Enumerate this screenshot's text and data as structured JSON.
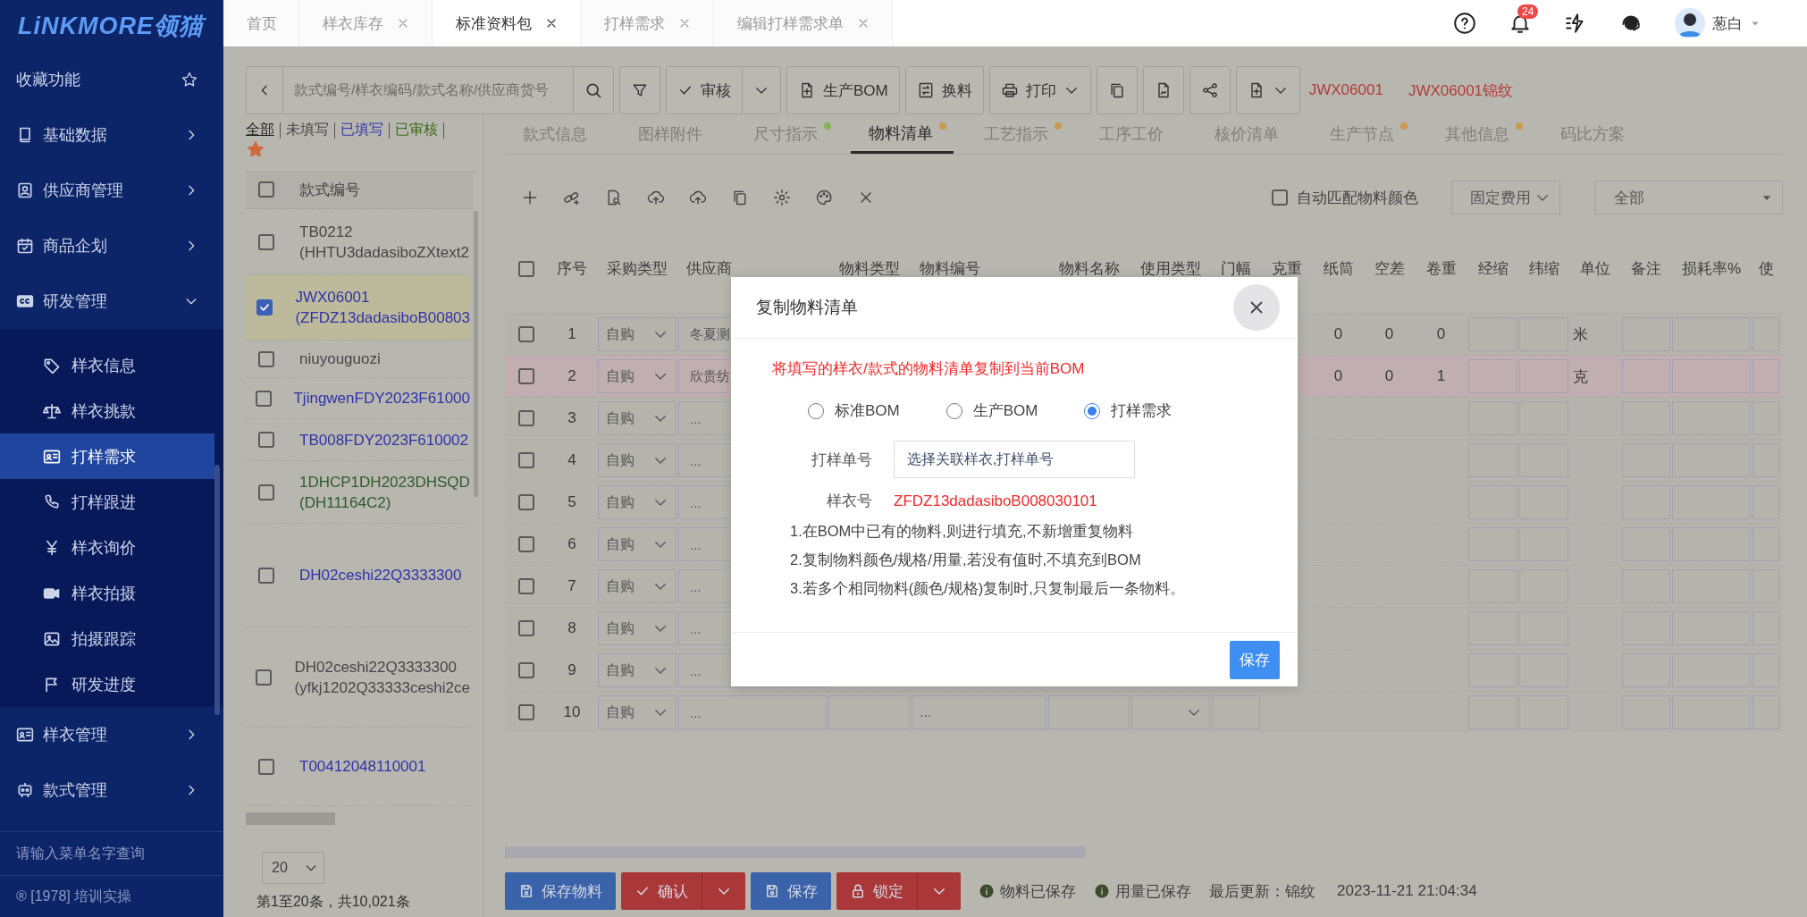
{
  "sidebar": {
    "logo": "LiNKMORE领猫",
    "items": [
      {
        "kind": "favorites",
        "label": "收藏功能"
      },
      {
        "kind": "menu",
        "label": "基础数据",
        "expanded": false
      },
      {
        "kind": "menu",
        "label": "供应商管理",
        "expanded": false
      },
      {
        "kind": "menu",
        "label": "商品企划",
        "expanded": false
      },
      {
        "kind": "menu",
        "label": "研发管理",
        "expanded": true,
        "children": [
          {
            "label": "样衣信息",
            "selected": false
          },
          {
            "label": "样衣挑款",
            "selected": false
          },
          {
            "label": "打样需求",
            "selected": true
          },
          {
            "label": "打样跟进",
            "selected": false
          },
          {
            "label": "样衣询价",
            "selected": false
          },
          {
            "label": "样衣拍摄",
            "selected": false
          },
          {
            "label": "拍摄跟踪",
            "selected": false
          },
          {
            "label": "研发进度",
            "selected": false
          }
        ]
      },
      {
        "kind": "menu",
        "label": "样衣管理",
        "expanded": false
      },
      {
        "kind": "menu",
        "label": "款式管理",
        "expanded": false
      }
    ],
    "search_placeholder": "请输入菜单名字查询",
    "footer": "® [1978] 培训实操"
  },
  "header": {
    "tabs": [
      {
        "label": "首页",
        "closable": false,
        "selected": false
      },
      {
        "label": "样衣库存",
        "closable": true,
        "selected": false
      },
      {
        "label": "标准资料包",
        "closable": true,
        "selected": true
      },
      {
        "label": "打样需求",
        "closable": true,
        "selected": false
      },
      {
        "label": "编辑打样需求单",
        "closable": true,
        "selected": false
      }
    ],
    "notification_count": "24",
    "user": "葱白"
  },
  "toolbar": {
    "search_placeholder": "款式编号/样衣编码/款式名称/供应商货号",
    "buttons": [
      {
        "kind": "icon",
        "caret": false
      },
      {
        "kind": "split",
        "label": "审核",
        "caret": true
      },
      {
        "kind": "text",
        "label": "生产BOM",
        "caret": false
      },
      {
        "kind": "text",
        "label": "换料",
        "caret": false
      },
      {
        "kind": "text",
        "label": "打印",
        "caret": true
      },
      {
        "kind": "icon",
        "caret": false
      },
      {
        "kind": "icon",
        "caret": false
      },
      {
        "kind": "icon",
        "caret": false
      },
      {
        "kind": "icon",
        "caret": true
      }
    ],
    "codes": [
      "JWX06001",
      "JWX06001锦纹"
    ]
  },
  "list": {
    "filters": [
      {
        "label": "全部",
        "selected": true,
        "color": "#1e1e1e"
      },
      {
        "label": "未填写",
        "selected": false,
        "color": "#474747"
      },
      {
        "label": "已填写",
        "selected": false,
        "color": "#3636b0"
      },
      {
        "label": "已审核",
        "selected": false,
        "color": "#3c6a1c"
      }
    ],
    "column": "款式编号",
    "select_all_checked": false,
    "rows": [
      {
        "lines": [
          "TB0212",
          "(HHTU3dadasiboZXtext2"
        ],
        "checked": false,
        "selected": false,
        "color": "#474747"
      },
      {
        "lines": [
          "JWX06001",
          "(ZFDZ13dadasiboB00803"
        ],
        "checked": true,
        "selected": true,
        "color": "#3232a8"
      },
      {
        "lines": [
          "niuyouguozi"
        ],
        "checked": false,
        "selected": false,
        "color": "#474747"
      },
      {
        "lines": [
          "TjingwenFDY2023F61000"
        ],
        "checked": false,
        "selected": false,
        "color": "#3232a8"
      },
      {
        "lines": [
          "TB008FDY2023F610002"
        ],
        "checked": false,
        "selected": false,
        "color": "#3232a8"
      },
      {
        "lines": [
          "1DHCP1DH2023DHSQD",
          "(DH11164C2)"
        ],
        "checked": false,
        "selected": false,
        "color": "#2f5a2f"
      },
      {
        "lines": [
          "DH02ceshi22Q3333300"
        ],
        "checked": false,
        "selected": false,
        "color": "#3232a8"
      },
      {
        "lines": [
          "DH02ceshi22Q3333300",
          "(yfkj1202Q33333ceshi2ce"
        ],
        "checked": false,
        "selected": false,
        "color": "#474747"
      },
      {
        "lines": [
          "T00412048110001"
        ],
        "checked": false,
        "selected": false,
        "color": "#3232a8"
      }
    ],
    "page_size": "20",
    "summary": "第1至20条，共10,021条"
  },
  "main": {
    "tabs": [
      {
        "label": "款式信息",
        "selected": false
      },
      {
        "label": "图样附件",
        "selected": false
      },
      {
        "label": "尺寸指示",
        "selected": false,
        "color": "#86b25e"
      },
      {
        "label": "物料清单",
        "selected": true,
        "color": "#c99a50"
      },
      {
        "label": "工艺指示",
        "selected": false,
        "color": "#c99a50"
      },
      {
        "label": "工序工价",
        "selected": false
      },
      {
        "label": "核价清单",
        "selected": false
      },
      {
        "label": "生产节点",
        "selected": false,
        "color": "#c99a50"
      },
      {
        "label": "其他信息",
        "selected": false,
        "color": "#c99a50"
      },
      {
        "label": "码比方案",
        "selected": false
      }
    ],
    "auto_match": {
      "label": "自动匹配物料颜色",
      "checked": false
    },
    "selects": [
      "固定费用",
      "全部"
    ],
    "table": {
      "select_all_checked": false,
      "columns": [
        "序号",
        "采购类型",
        "供应商",
        "物料类型",
        "物料编号",
        "物料名称",
        "使用类型",
        "门幅",
        "克重",
        "纸筒",
        "空差",
        "卷重",
        "经缩",
        "纬缩",
        "单位",
        "备注",
        "损耗率%",
        "使"
      ],
      "rows": [
        {
          "seq": "1",
          "purchase_type": "自购",
          "supplier": "冬夏测",
          "checked": false,
          "highlighted": false,
          "paper_tube": "0",
          "gap": "0",
          "roll_weight": "0",
          "unit": "米"
        },
        {
          "seq": "2",
          "purchase_type": "自购",
          "supplier": "欣贵纺",
          "checked": false,
          "highlighted": true,
          "paper_tube": "0",
          "gap": "0",
          "roll_weight": "1",
          "unit": "克"
        },
        {
          "seq": "3",
          "purchase_type": "自购",
          "supplier": "...",
          "checked": false,
          "highlighted": false
        },
        {
          "seq": "4",
          "purchase_type": "自购",
          "supplier": "...",
          "checked": false,
          "highlighted": false
        },
        {
          "seq": "5",
          "purchase_type": "自购",
          "supplier": "...",
          "checked": false,
          "highlighted": false
        },
        {
          "seq": "6",
          "purchase_type": "自购",
          "supplier": "...",
          "checked": false,
          "highlighted": false
        },
        {
          "seq": "7",
          "purchase_type": "自购",
          "supplier": "...",
          "checked": false,
          "highlighted": false
        },
        {
          "seq": "8",
          "purchase_type": "自购",
          "supplier": "...",
          "checked": false,
          "highlighted": false
        },
        {
          "seq": "9",
          "purchase_type": "自购",
          "supplier": "...",
          "checked": false,
          "highlighted": false
        },
        {
          "seq": "10",
          "purchase_type": "自购",
          "supplier": "...",
          "checked": false,
          "highlighted": false,
          "material_code": "...",
          "usage_select": true
        }
      ]
    },
    "actions": [
      {
        "label": "保存物料",
        "kind": "primary",
        "caret": false
      },
      {
        "label": "确认",
        "kind": "danger",
        "caret": true
      },
      {
        "label": "保存",
        "kind": "primary",
        "caret": false
      },
      {
        "label": "锁定",
        "kind": "danger",
        "caret": true
      }
    ],
    "statuses": [
      "物料已保存",
      "用量已保存"
    ],
    "last_update": "最后更新：锦纹",
    "timestamp": "2023-11-21 21:04:34"
  },
  "dialog": {
    "title": "复制物料清单",
    "notice": "将填写的样衣/款式的物料清单复制到当前BOM",
    "options": [
      {
        "label": "标准BOM",
        "selected": false
      },
      {
        "label": "生产BOM",
        "selected": false
      },
      {
        "label": "打样需求",
        "selected": true
      }
    ],
    "order_label": "打样单号",
    "order_placeholder": "选择关联样衣,打样单号",
    "sample_label": "样衣号",
    "sample_value": "ZFDZ13dadasiboB008030101",
    "notes": [
      "1.在BOM中已有的物料,则进行填充,不新增重复物料",
      "2.复制物料颜色/规格/用量,若没有值时,不填充到BOM",
      "3.若多个相同物料(颜色/规格)复制时,只复制最后一条物料。"
    ],
    "save": "保存"
  }
}
